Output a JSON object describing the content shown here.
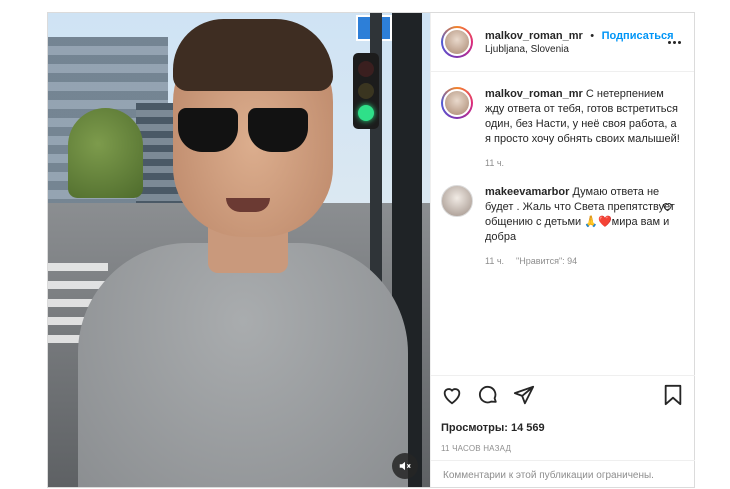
{
  "post": {
    "author": {
      "username": "malkov_roman_mr",
      "follow_label": "Подписаться",
      "location": "Ljubljana, Slovenia",
      "separator": "•"
    },
    "caption": {
      "username": "malkov_roman_mr",
      "text": "С нетерпением жду ответа от тебя, готов встретиться один, без Насти, у неё своя работа, а я просто хочу обнять своих малышей!",
      "time": "11 ч."
    },
    "comments": [
      {
        "username": "makeevamarbor",
        "text": "Думаю ответа не будет . Жаль что Света препятствует общению с детьми 🙏❤️мира вам и добра",
        "time": "11 ч.",
        "likes": "\"Нравится\": 94"
      }
    ],
    "views_label": "Просмотры:",
    "views_count": "14 569",
    "posted_ago": "11 ЧАСОВ НАЗАД",
    "comments_disabled": "Комментарии к этой публикации ограничены."
  },
  "icons": {
    "like": "heart-icon",
    "comment": "comment-icon",
    "share": "paper-plane-icon",
    "save": "bookmark-icon",
    "mute": "speaker-muted-icon",
    "more": "more-options-icon"
  },
  "colors": {
    "accent": "#0095f6",
    "muted_text": "#8e8e8e",
    "border": "#dbdbdb"
  }
}
